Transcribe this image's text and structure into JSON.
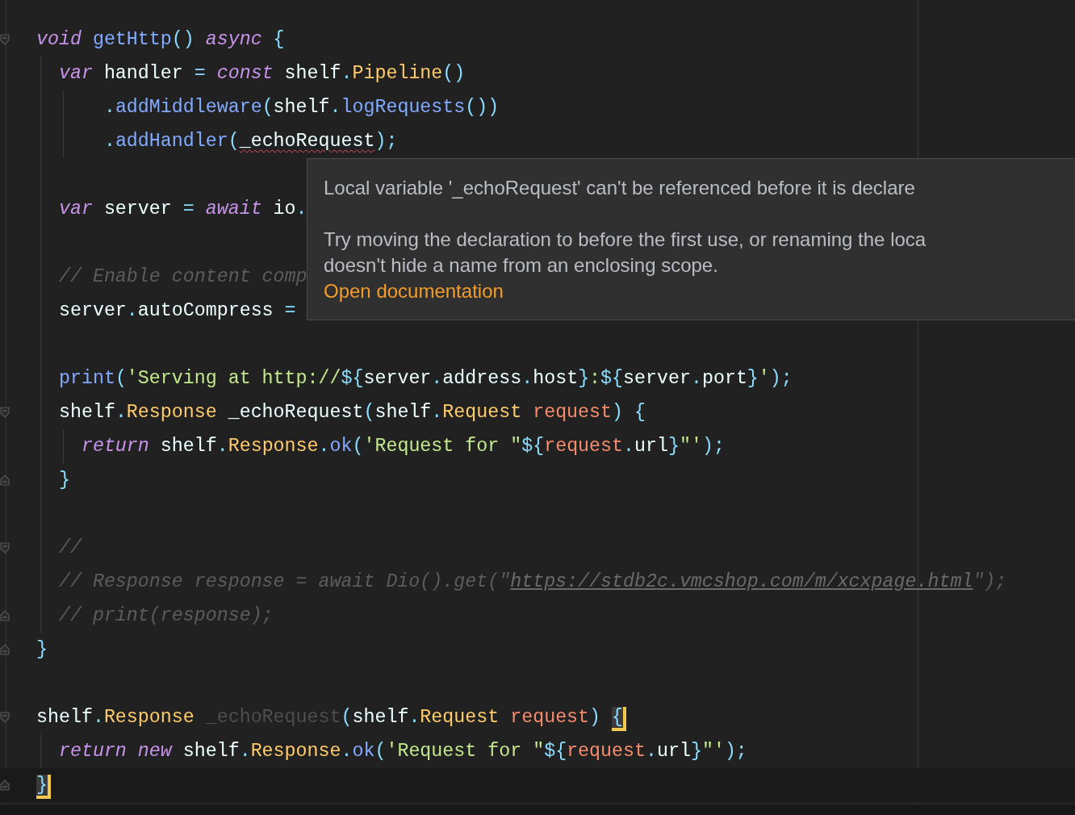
{
  "editor": {
    "lines": [
      {
        "kind": "code",
        "fold_start": true,
        "tokens": [
          {
            "text": "void",
            "kind": "kw"
          },
          {
            "text": " getHttp",
            "kind": "fn"
          },
          {
            "text": "()",
            "kind": "punc"
          },
          {
            "text": " async",
            "kind": "kw"
          },
          {
            "text": " {",
            "kind": "punc"
          }
        ]
      },
      {
        "kind": "code",
        "tokens": [
          {
            "text": "  var",
            "kind": "kw"
          },
          {
            "text": " handler ",
            "kind": "plain"
          },
          {
            "text": "=",
            "kind": "punc"
          },
          {
            "text": " const",
            "kind": "kw"
          },
          {
            "text": " shelf",
            "kind": "plain"
          },
          {
            "text": ".",
            "kind": "punc"
          },
          {
            "text": "Pipeline",
            "kind": "type"
          },
          {
            "text": "()",
            "kind": "punc"
          }
        ]
      },
      {
        "kind": "code",
        "tokens": [
          {
            "text": "      .",
            "kind": "punc"
          },
          {
            "text": "addMiddleware",
            "kind": "fn"
          },
          {
            "text": "(",
            "kind": "punc"
          },
          {
            "text": "shelf",
            "kind": "plain"
          },
          {
            "text": ".",
            "kind": "punc"
          },
          {
            "text": "logRequests",
            "kind": "fn"
          },
          {
            "text": "())",
            "kind": "punc"
          }
        ]
      },
      {
        "kind": "code",
        "tokens": [
          {
            "text": "      .",
            "kind": "punc"
          },
          {
            "text": "addHandler",
            "kind": "fn"
          },
          {
            "text": "(",
            "kind": "punc"
          },
          {
            "text": "_echoRequest",
            "kind": "error"
          },
          {
            "text": ");",
            "kind": "punc"
          }
        ]
      },
      {
        "kind": "blank"
      },
      {
        "kind": "code",
        "tokens": [
          {
            "text": "  var",
            "kind": "kw"
          },
          {
            "text": " server ",
            "kind": "plain"
          },
          {
            "text": "=",
            "kind": "punc"
          },
          {
            "text": " await",
            "kind": "kw"
          },
          {
            "text": " io",
            "kind": "plain"
          },
          {
            "text": ".",
            "kind": "punc"
          }
        ]
      },
      {
        "kind": "blank"
      },
      {
        "kind": "code",
        "tokens": [
          {
            "text": "  // Enable content comp",
            "kind": "comment"
          }
        ]
      },
      {
        "kind": "code",
        "tokens": [
          {
            "text": "  server",
            "kind": "plain"
          },
          {
            "text": ".",
            "kind": "punc"
          },
          {
            "text": "autoCompress ",
            "kind": "plain"
          },
          {
            "text": "=",
            "kind": "punc"
          }
        ]
      },
      {
        "kind": "blank"
      },
      {
        "kind": "code",
        "tokens": [
          {
            "text": "  print",
            "kind": "fn"
          },
          {
            "text": "(",
            "kind": "punc"
          },
          {
            "text": "'Serving at http://",
            "kind": "str"
          },
          {
            "text": "${",
            "kind": "punc"
          },
          {
            "text": "server",
            "kind": "plain"
          },
          {
            "text": ".",
            "kind": "punc"
          },
          {
            "text": "address",
            "kind": "plain"
          },
          {
            "text": ".",
            "kind": "punc"
          },
          {
            "text": "host",
            "kind": "plain"
          },
          {
            "text": "}",
            "kind": "punc"
          },
          {
            "text": ":",
            "kind": "str"
          },
          {
            "text": "${",
            "kind": "punc"
          },
          {
            "text": "server",
            "kind": "plain"
          },
          {
            "text": ".",
            "kind": "punc"
          },
          {
            "text": "port",
            "kind": "plain"
          },
          {
            "text": "}",
            "kind": "punc"
          },
          {
            "text": "'",
            "kind": "str"
          },
          {
            "text": ");",
            "kind": "punc"
          }
        ]
      },
      {
        "kind": "code",
        "fold_start": true,
        "tokens": [
          {
            "text": "  shelf",
            "kind": "plain"
          },
          {
            "text": ".",
            "kind": "punc"
          },
          {
            "text": "Response",
            "kind": "type"
          },
          {
            "text": " _echoRequest",
            "kind": "plain"
          },
          {
            "text": "(",
            "kind": "punc"
          },
          {
            "text": "shelf",
            "kind": "plain"
          },
          {
            "text": ".",
            "kind": "punc"
          },
          {
            "text": "Request",
            "kind": "type"
          },
          {
            "text": " request",
            "kind": "param"
          },
          {
            "text": ") {",
            "kind": "punc"
          }
        ]
      },
      {
        "kind": "code",
        "tokens": [
          {
            "text": "    return",
            "kind": "kw"
          },
          {
            "text": " shelf",
            "kind": "plain"
          },
          {
            "text": ".",
            "kind": "punc"
          },
          {
            "text": "Response",
            "kind": "type"
          },
          {
            "text": ".",
            "kind": "punc"
          },
          {
            "text": "ok",
            "kind": "fn"
          },
          {
            "text": "(",
            "kind": "punc"
          },
          {
            "text": "'Request for \"",
            "kind": "str"
          },
          {
            "text": "${",
            "kind": "punc"
          },
          {
            "text": "request",
            "kind": "param"
          },
          {
            "text": ".",
            "kind": "punc"
          },
          {
            "text": "url",
            "kind": "plain"
          },
          {
            "text": "}",
            "kind": "punc"
          },
          {
            "text": "\"'",
            "kind": "str"
          },
          {
            "text": ");",
            "kind": "punc"
          }
        ]
      },
      {
        "kind": "code",
        "fold_end": true,
        "tokens": [
          {
            "text": "  }",
            "kind": "punc"
          }
        ]
      },
      {
        "kind": "blank"
      },
      {
        "kind": "code",
        "fold_start": true,
        "tokens": [
          {
            "text": "  //",
            "kind": "comment"
          }
        ]
      },
      {
        "kind": "code",
        "tokens": [
          {
            "text": "  // Response response = await Dio().get(\"",
            "kind": "comment"
          },
          {
            "text": "https://stdb2c.vmcshop.com/m/xcxpage.html",
            "kind": "link"
          },
          {
            "text": "\");",
            "kind": "comment"
          }
        ]
      },
      {
        "kind": "code",
        "fold_end": true,
        "tokens": [
          {
            "text": "  // print(response);",
            "kind": "comment"
          }
        ]
      },
      {
        "kind": "code",
        "fold_end": true,
        "tokens": [
          {
            "text": "}",
            "kind": "punc"
          }
        ]
      },
      {
        "kind": "blank"
      },
      {
        "kind": "code",
        "fold_start": true,
        "tokens": [
          {
            "text": "shelf",
            "kind": "plain"
          },
          {
            "text": ".",
            "kind": "punc"
          },
          {
            "text": "Response",
            "kind": "type"
          },
          {
            "text": " _echoRequest",
            "kind": "unused"
          },
          {
            "text": "(",
            "kind": "punc"
          },
          {
            "text": "shelf",
            "kind": "plain"
          },
          {
            "text": ".",
            "kind": "punc"
          },
          {
            "text": "Request",
            "kind": "type"
          },
          {
            "text": " request",
            "kind": "param"
          },
          {
            "text": ") ",
            "kind": "punc"
          },
          {
            "text": "{",
            "kind": "brace_match"
          }
        ]
      },
      {
        "kind": "code",
        "tokens": [
          {
            "text": "  return",
            "kind": "kw"
          },
          {
            "text": " new",
            "kind": "kw"
          },
          {
            "text": " shelf",
            "kind": "plain"
          },
          {
            "text": ".",
            "kind": "punc"
          },
          {
            "text": "Response",
            "kind": "type"
          },
          {
            "text": ".",
            "kind": "punc"
          },
          {
            "text": "ok",
            "kind": "fn"
          },
          {
            "text": "(",
            "kind": "punc"
          },
          {
            "text": "'Request for \"",
            "kind": "str"
          },
          {
            "text": "${",
            "kind": "punc"
          },
          {
            "text": "request",
            "kind": "param"
          },
          {
            "text": ".",
            "kind": "punc"
          },
          {
            "text": "url",
            "kind": "plain"
          },
          {
            "text": "}",
            "kind": "punc"
          },
          {
            "text": "\"'",
            "kind": "str"
          },
          {
            "text": ");",
            "kind": "punc"
          }
        ]
      },
      {
        "kind": "code",
        "fold_end": true,
        "current": true,
        "tokens": [
          {
            "text": "}",
            "kind": "brace_match"
          }
        ]
      }
    ]
  },
  "tooltip": {
    "message": "Local variable '_echoRequest' can't be referenced before it is declare",
    "hint_lines": [
      "Try moving the declaration to before the first use, or renaming the loca",
      "doesn't hide a name from an enclosing scope."
    ],
    "link": "Open documentation"
  }
}
